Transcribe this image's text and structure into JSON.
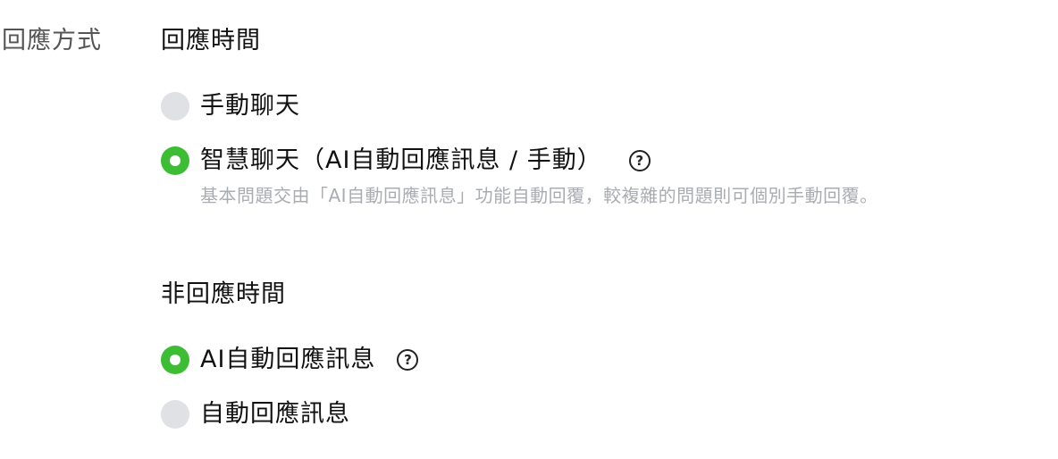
{
  "field_label": "回應方式",
  "business_hours": {
    "title": "回應時間",
    "options": [
      {
        "label": "手動聊天",
        "selected": false
      },
      {
        "label": "智慧聊天（AI自動回應訊息 / 手動）",
        "selected": true
      }
    ],
    "hint": "基本問題交由「AI自動回應訊息」功能自動回覆，較複雜的問題則可個別手動回覆。"
  },
  "off_hours": {
    "title": "非回應時間",
    "options": [
      {
        "label": "AI自動回應訊息",
        "selected": true
      },
      {
        "label": "自動回應訊息",
        "selected": false
      }
    ]
  },
  "help_icon_glyph": "?",
  "colors": {
    "radio_selected": "#3dbd34",
    "radio_unselected": "#dfe1e5",
    "hint_text": "#a9acb1",
    "label_text": "#555555"
  }
}
